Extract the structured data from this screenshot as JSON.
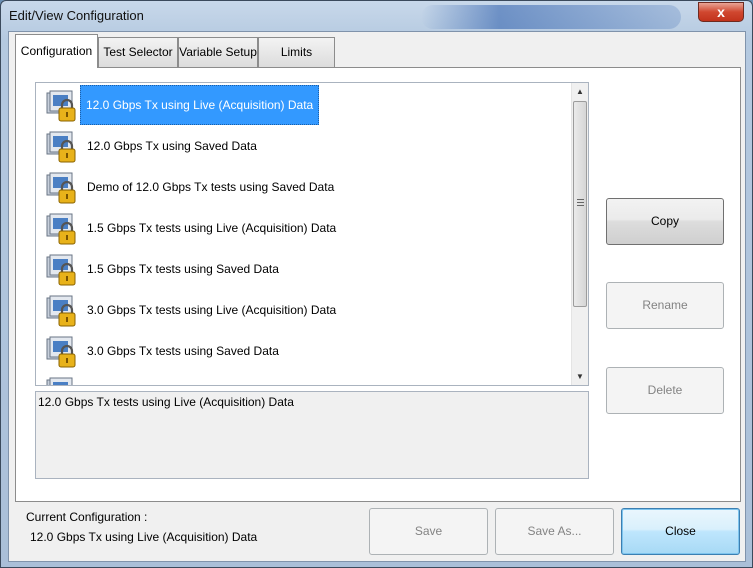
{
  "window": {
    "title": "Edit/View Configuration",
    "close_glyph": "x"
  },
  "tabs": [
    {
      "label": "Configuration",
      "active": true
    },
    {
      "label": "Test Selector",
      "active": false
    },
    {
      "label": "Variable Setup",
      "active": false
    },
    {
      "label": "Limits",
      "active": false
    }
  ],
  "config_list": {
    "items": [
      {
        "label": "12.0 Gbps Tx using Live (Acquisition) Data",
        "selected": true,
        "icon": "locked-config-icon"
      },
      {
        "label": "12.0 Gbps Tx using Saved Data",
        "selected": false,
        "icon": "locked-config-icon"
      },
      {
        "label": "Demo of 12.0 Gbps Tx tests using  Saved Data",
        "selected": false,
        "icon": "locked-config-icon"
      },
      {
        "label": "1.5 Gbps Tx tests using Live (Acquisition) Data",
        "selected": false,
        "icon": "locked-config-icon"
      },
      {
        "label": "1.5 Gbps Tx tests using Saved Data",
        "selected": false,
        "icon": "locked-config-icon"
      },
      {
        "label": "3.0 Gbps Tx tests using Live (Acquisition) Data",
        "selected": false,
        "icon": "locked-config-icon"
      },
      {
        "label": "3.0 Gbps Tx tests using Saved Data",
        "selected": false,
        "icon": "locked-config-icon"
      },
      {
        "label": "",
        "selected": false,
        "icon": "locked-config-icon"
      }
    ]
  },
  "description": "12.0 Gbps Tx tests using Live (Acquisition) Data",
  "side_buttons": {
    "copy": "Copy",
    "rename": "Rename",
    "delete": "Delete"
  },
  "footer": {
    "current_label": "Current Configuration :",
    "current_value": "12.0 Gbps Tx using Live (Acquisition) Data",
    "save": "Save",
    "save_as": "Save As...",
    "close": "Close"
  },
  "colors": {
    "selection": "#3399ff",
    "title_close": "#c2331c",
    "lock": "#e8b21a"
  }
}
